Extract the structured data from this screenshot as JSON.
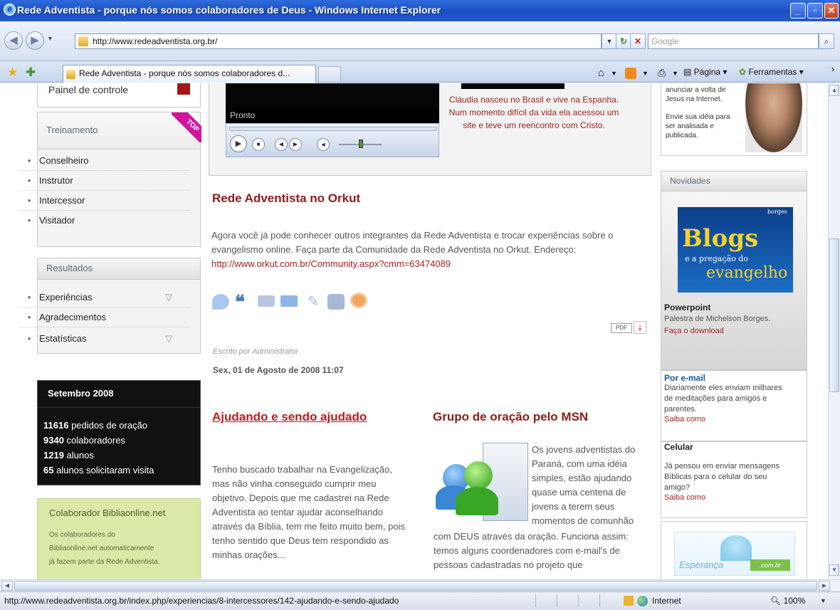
{
  "window": {
    "title": "Rede Adventista - porque nós somos colaboradores de Deus - Windows Internet Explorer"
  },
  "toolbar": {
    "address": "http://www.redeadventista.org.br/",
    "search_placeholder": "Google",
    "tab_label": "Rede Adventista - porque nós somos colaboradores d...",
    "page_menu": "Página",
    "tools_menu": "Ferramentas"
  },
  "sidebar": {
    "control_panel": "Painel de controle",
    "training": {
      "title": "Treinamento",
      "ribbon": "TOP",
      "items": [
        "Conselheiro",
        "Instrutor",
        "Intercessor",
        "Visitador"
      ]
    },
    "results": {
      "title": "Resultados",
      "items": [
        "Experiências",
        "Agradecimentos",
        "Estatísticas"
      ]
    },
    "stats": {
      "title": "Setembro 2008",
      "rows": [
        {
          "num": "11616",
          "text": "pedidos de oração"
        },
        {
          "num": "9340",
          "text": "colaboradores"
        },
        {
          "num": "1219",
          "text": "alunos"
        },
        {
          "num": "65",
          "text": "alunos solicitaram visita"
        }
      ]
    },
    "biblia": {
      "title": "Colaborador Bibliaonline.net",
      "text": [
        "Os colaboradores do",
        "Bibliaonline.net automaticamente",
        "já fazem parte da Rede Adventista."
      ]
    }
  },
  "video": {
    "status": "Pronto",
    "caption": [
      "Cláudia nasceu no Brasil e vive na Espanha.",
      "Num momento difícil da vida ela acessou um",
      "site e teve um reencontro com Cristo."
    ]
  },
  "orkut": {
    "title": "Rede Adventista no Orkut",
    "text": [
      "Agora você já pode conhecer outros integrantes da Rede Adventista e trocar experiências sobre o",
      "evangelismo online. Faça parte da Comunidade da Rede Adventista no Orkut. Endereço:"
    ],
    "link": "http://www.orkut.com.br/Community.aspx?cmm=63474089",
    "pdf": "PDF",
    "author": "Escrito por Administrator",
    "date": "Sex, 01 de Agosto de 2008 11:07"
  },
  "article1": {
    "title": "Ajudando e sendo ajudado",
    "lines": [
      "Tenho buscado trabalhar na Evangelização,",
      " mas não vinha conseguido cumprir meu",
      "objetivo. Depois que me cadastrei na Rede",
      "Adventista ao tentar ajudar aconselhando",
      "através da Bíblia, tem me feito muito bem, pois",
      "tenho sentido que Deus tem respondido as",
      "minhas orações..."
    ]
  },
  "article2": {
    "title": "Grupo de oração pelo MSN",
    "lines_right": [
      "Os jovens adventistas do",
      "Paraná, com uma idéia",
      "simples, estão ajudando",
      "quase uma centena de",
      "jovens a terem seus",
      "momentos de comunhão"
    ],
    "lines_full": [
      "com DEUS através da oração. Funciona assim:",
      "temos alguns coordenadores com e-mail's de",
      "pessoas cadastradas no projeto que"
    ]
  },
  "right": {
    "promo": [
      "anunciar a volta de",
      "Jesus na Internet.",
      "",
      "Envie sua idéia para",
      "ser analisada e",
      "publicada."
    ],
    "news_title": "Novidades",
    "blogs": {
      "line1": "Blogs",
      "line2": "e a pregação do",
      "line3": "evangelho",
      "tag": "borges"
    },
    "powerpoint": {
      "title": "Powerpoint",
      "text": "Palestra de Michelson Borges.",
      "link": "Faça o download"
    },
    "email": {
      "title": "Por e-mail",
      "text": [
        "Diariamente eles enviam milhares",
        "de meditações para amigos e",
        "parentes."
      ],
      "link": "Saiba como"
    },
    "celular": {
      "title": "Celular",
      "text": [
        "Já pensou em enviar mensagens",
        "Bíblicas para o celular do seu",
        "amigo?"
      ],
      "link": "Saiba como"
    },
    "esperanca": {
      "text": "Esperança",
      "tld": ".com.br"
    }
  },
  "status": {
    "url": "http://www.redeadventista.org.br/index.php/experiencias/8-intercessores/142-ajudando-e-sendo-ajudado",
    "zone": "Internet",
    "zoom": "100%"
  },
  "colors": {
    "accent_red": "#a32020",
    "ie_blue": "#1b4fc0"
  }
}
